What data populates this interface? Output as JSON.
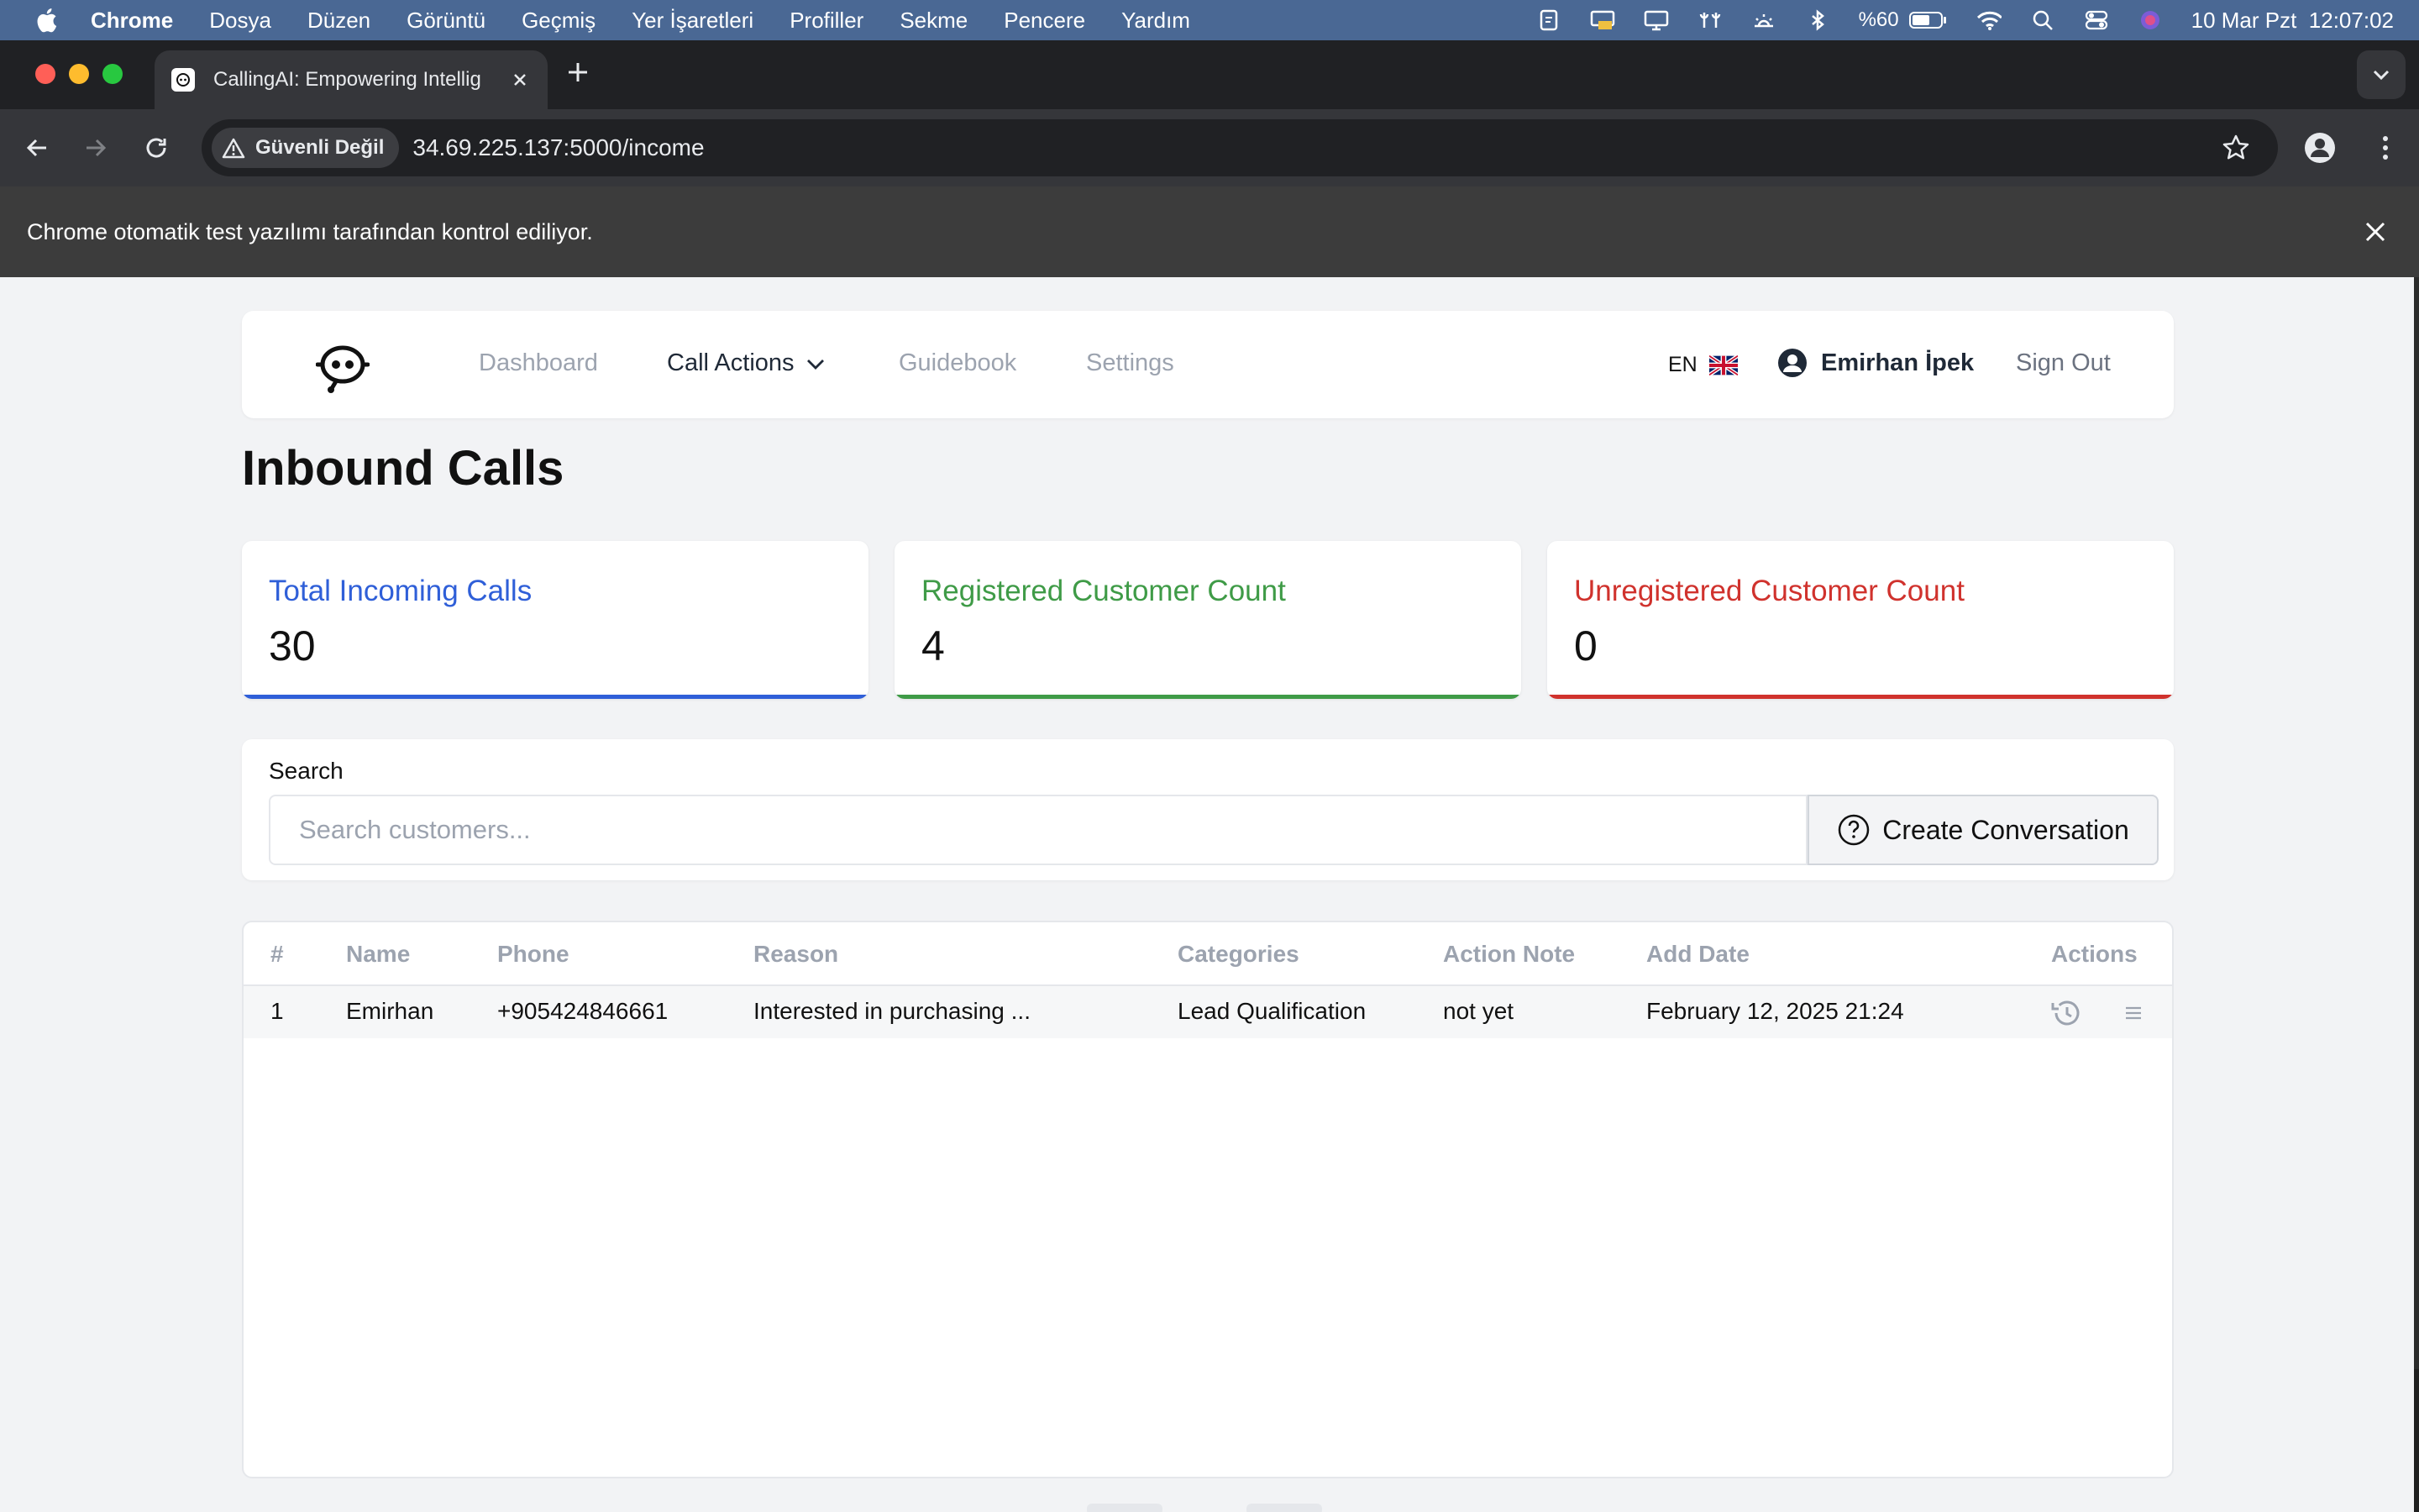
{
  "menubar": {
    "app_name": "Chrome",
    "menus": [
      "Dosya",
      "Düzen",
      "Görüntü",
      "Geçmiş",
      "Yer İşaretleri",
      "Profiller",
      "Sekme",
      "Pencere",
      "Yardım"
    ],
    "battery": "%60",
    "datetime": "10 Mar Pzt  12:07:02"
  },
  "browser": {
    "tab_title": "CallingAI: Empowering Intellig",
    "security_chip": "Güvenli Değil",
    "url": "34.69.225.137:5000/income",
    "infobar_text": "Chrome otomatik test yazılımı tarafından kontrol ediliyor."
  },
  "nav": {
    "links": [
      "Dashboard",
      "Call Actions",
      "Guidebook",
      "Settings"
    ],
    "language": "EN",
    "user_name": "Emirhan İpek",
    "sign_out": "Sign Out"
  },
  "page": {
    "title": "Inbound Calls"
  },
  "stats": [
    {
      "label": "Total Incoming Calls",
      "value": "30",
      "color": "#2f5fd8"
    },
    {
      "label": "Registered Customer Count",
      "value": "4",
      "color": "#3f9b47"
    },
    {
      "label": "Unregistered Customer Count",
      "value": "0",
      "color": "#d0322d"
    }
  ],
  "search": {
    "label": "Search",
    "placeholder": "Search customers...",
    "create_button": "Create Conversation"
  },
  "table": {
    "headers": [
      "#",
      "Name",
      "Phone",
      "Reason",
      "Categories",
      "Action Note",
      "Add Date",
      "Actions"
    ],
    "rows": [
      {
        "index": "1",
        "name": "Emirhan",
        "phone": "+905424846661",
        "reason": "Interested in purchasing ...",
        "category": "Lead Qualification",
        "action_note": "not yet",
        "add_date": "February 12, 2025 21:24",
        "actions": [
          "history-icon",
          "list-icon"
        ]
      }
    ]
  }
}
